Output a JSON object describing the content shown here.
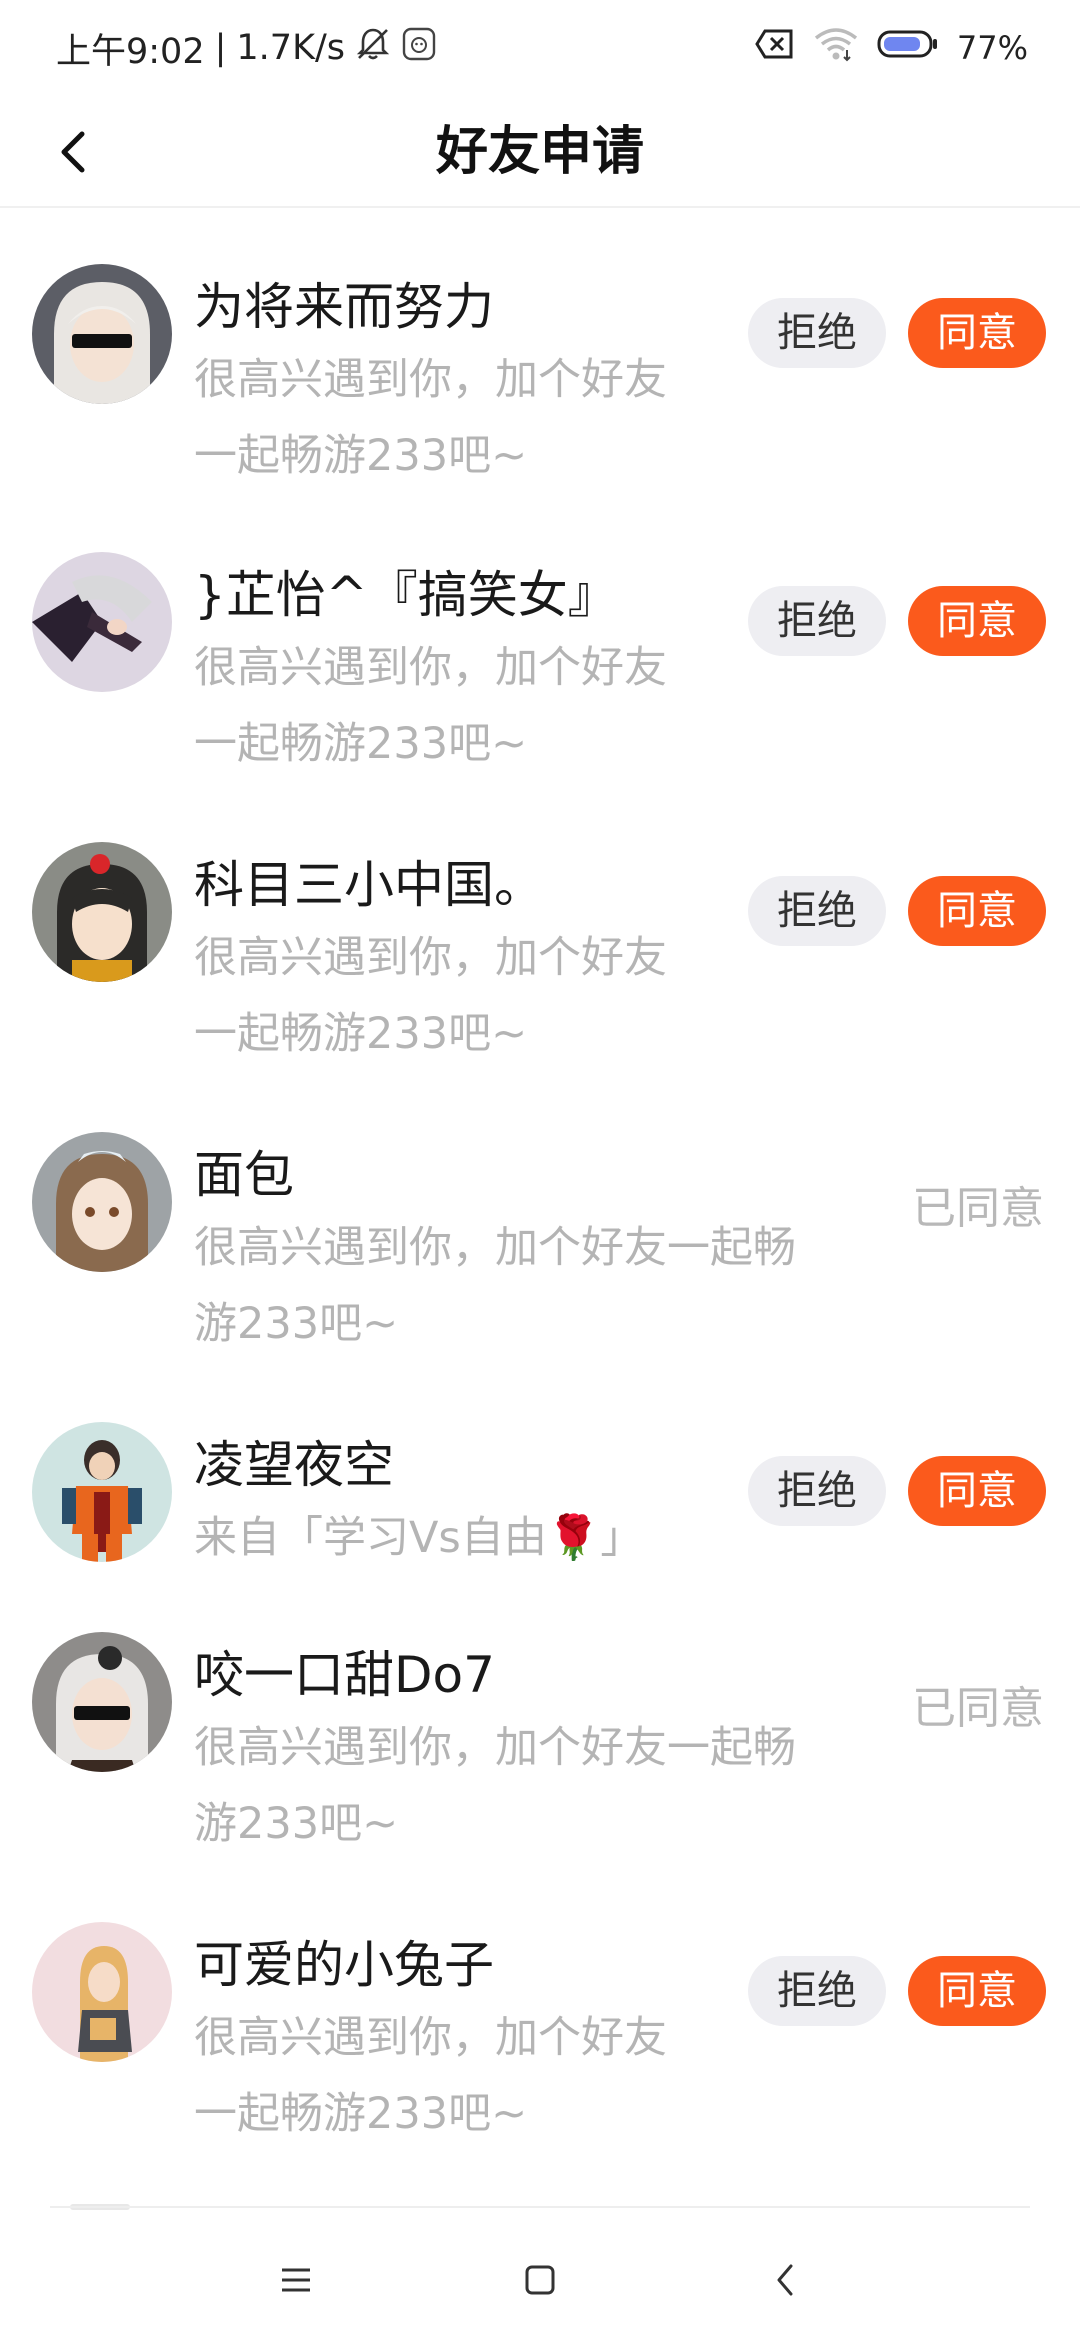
{
  "status_bar": {
    "time": "上午9:02",
    "speed": "1.7K/s",
    "battery": "77%",
    "icons": [
      "bell-off-icon",
      "app-notification-icon",
      "sim-off-icon",
      "wifi-icon",
      "battery-icon"
    ]
  },
  "header": {
    "title": "好友申请",
    "back_icon": "chevron-left-icon"
  },
  "requests": [
    {
      "name": "为将来而努力",
      "message_line1": "很高兴遇到你，加个好友",
      "message_line2": "一起畅游233吧~",
      "state": "pending",
      "reject_label": "拒绝",
      "accept_label": "同意"
    },
    {
      "name": "}芷怡^『搞笑女』",
      "message_line1": "很高兴遇到你，加个好友",
      "message_line2": "一起畅游233吧~",
      "state": "pending",
      "reject_label": "拒绝",
      "accept_label": "同意"
    },
    {
      "name": "科目三小中国。",
      "message_line1": "很高兴遇到你，加个好友",
      "message_line2": "一起畅游233吧~",
      "state": "pending",
      "reject_label": "拒绝",
      "accept_label": "同意"
    },
    {
      "name": "面包",
      "message_line1": "很高兴遇到你，加个好友一起畅",
      "message_line2": "游233吧~",
      "state": "accepted",
      "status_label": "已同意"
    },
    {
      "name": "凌望夜空",
      "message_line1": "来自「学习Vs自由🌹」",
      "message_line2": "",
      "state": "pending",
      "reject_label": "拒绝",
      "accept_label": "同意"
    },
    {
      "name": "咬一口甜Do7",
      "message_line1": "很高兴遇到你，加个好友一起畅",
      "message_line2": "游233吧~",
      "state": "accepted",
      "status_label": "已同意"
    },
    {
      "name": "可爱的小兔子",
      "message_line1": "很高兴遇到你，加个好友",
      "message_line2": "一起畅游233吧~",
      "state": "pending",
      "reject_label": "拒绝",
      "accept_label": "同意"
    }
  ],
  "nav_bar": {
    "icons": [
      "menu-icon",
      "home-icon",
      "back-icon"
    ]
  },
  "colors": {
    "accept": "#fb5a1c",
    "reject_bg": "#eeeef2",
    "secondary_text": "#b4b4b4"
  }
}
